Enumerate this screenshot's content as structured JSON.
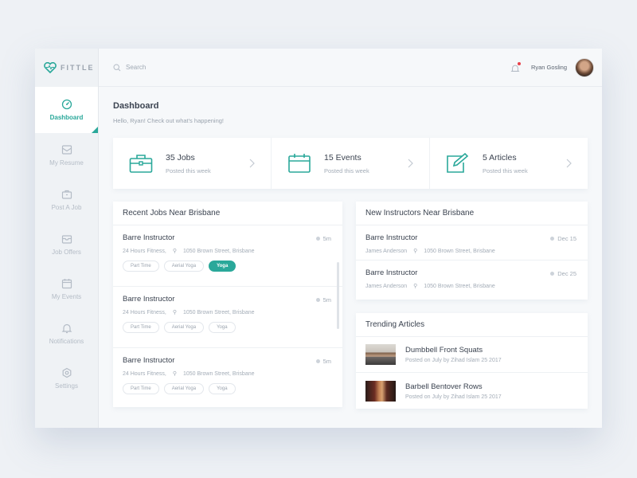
{
  "brand": {
    "name": "FITTLE",
    "accent": "#2aa89a"
  },
  "sidebar": {
    "items": [
      {
        "label": "Dashboard",
        "icon": "gauge-icon",
        "active": true
      },
      {
        "label": "My Resume",
        "icon": "inbox-icon"
      },
      {
        "label": "Post A Job",
        "icon": "briefcase-icon"
      },
      {
        "label": "Job Offers",
        "icon": "mail-icon"
      },
      {
        "label": "My Events",
        "icon": "calendar-icon"
      },
      {
        "label": "Notifications",
        "icon": "bell-icon"
      },
      {
        "label": "Settings",
        "icon": "gear-icon"
      }
    ]
  },
  "topbar": {
    "search_placeholder": "Search",
    "user_name": "Ryan Gosling",
    "notification_dot_color": "#e8414a"
  },
  "page": {
    "title": "Dashboard",
    "subtitle": "Hello, Ryan! Check out what's happening!"
  },
  "stats": [
    {
      "title": "35 Jobs",
      "sub": "Posted this week",
      "icon": "briefcase-icon"
    },
    {
      "title": "15 Events",
      "sub": "Posted this week",
      "icon": "calendar-icon"
    },
    {
      "title": "5 Articles",
      "sub": "Posted this week",
      "icon": "edit-icon"
    }
  ],
  "jobs": {
    "title": "Recent Jobs Near Brisbane",
    "items": [
      {
        "title": "Barre Instructor",
        "company": "24 Hours Fitness,",
        "address": "1050 Brown Street, Brisbane",
        "time": "5m",
        "tags": [
          "Part Time",
          "Aerial Yoga",
          "Yoga"
        ],
        "active_tag": "Yoga"
      },
      {
        "title": "Barre Instructor",
        "company": "24 Hours Fitness,",
        "address": "1050 Brown Street, Brisbane",
        "time": "5m",
        "tags": [
          "Part Time",
          "Aerial Yoga",
          "Yoga"
        ],
        "active_tag": ""
      },
      {
        "title": "Barre Instructor",
        "company": "24 Hours Fitness,",
        "address": "1050 Brown Street, Brisbane",
        "time": "5m",
        "tags": [
          "Part Time",
          "Aerial Yoga",
          "Yoga"
        ],
        "active_tag": ""
      }
    ]
  },
  "instructors": {
    "title": "New Instructors Near Brisbane",
    "items": [
      {
        "title": "Barre Instructor",
        "name": "James Anderson",
        "address": "1050 Brown Street, Brisbane",
        "date": "Dec 15"
      },
      {
        "title": "Barre Instructor",
        "name": "James Anderson",
        "address": "1050 Brown Street, Brisbane",
        "date": "Dec 25"
      }
    ]
  },
  "articles": {
    "title": "Trending Articles",
    "items": [
      {
        "title": "Dumbbell Front Squats",
        "meta": "Posted on July by Zihad Islam 25 2017"
      },
      {
        "title": "Barbell Bentover Rows",
        "meta": "Posted on July by Zihad Islam 25 2017"
      }
    ]
  }
}
